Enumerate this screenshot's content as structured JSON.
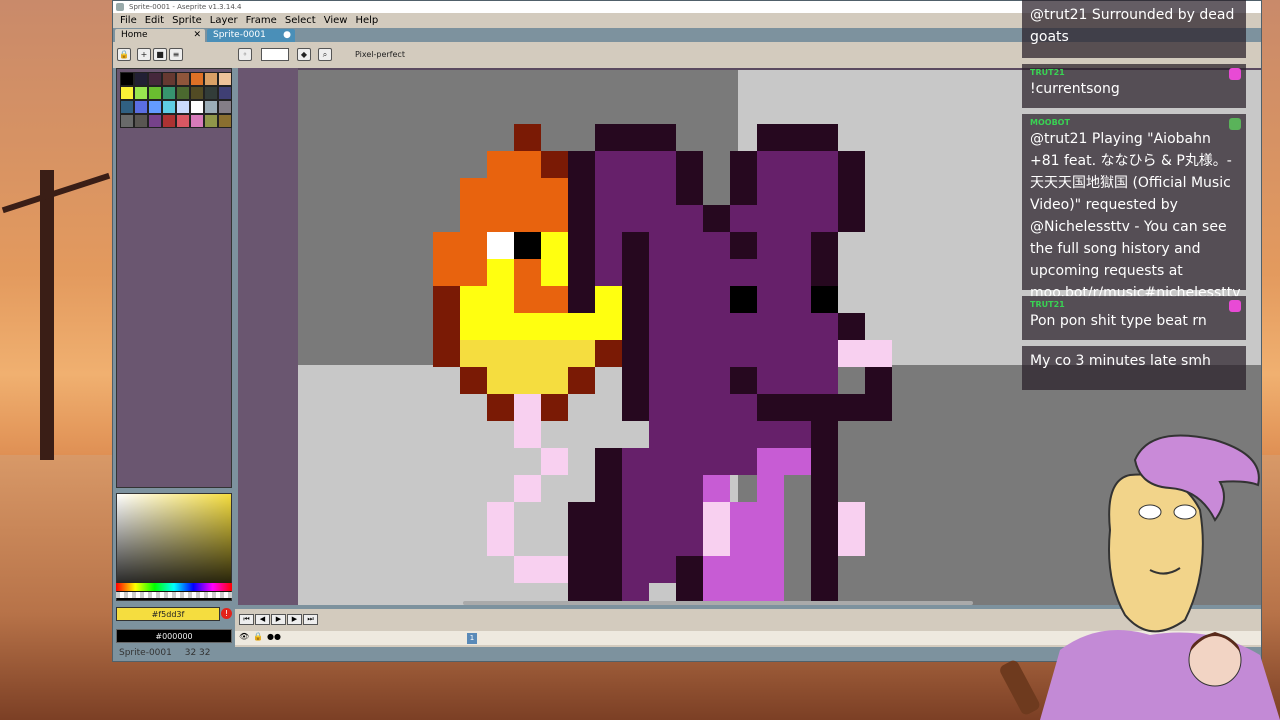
{
  "window": {
    "title": "Sprite-0001 - Aseprite v1.3.14.4"
  },
  "menu": [
    "File",
    "Edit",
    "Sprite",
    "Layer",
    "Frame",
    "Select",
    "View",
    "Help"
  ],
  "tabs": {
    "home": "Home",
    "sprite": "Sprite-0001"
  },
  "toolbar": {
    "pixel_perfect": "Pixel-perfect"
  },
  "colors": {
    "foreground_label": "#f5dd3f",
    "background_label": "#000000"
  },
  "status": {
    "sprite": "Sprite-0001",
    "dimensions": "32 32"
  },
  "timeline": {
    "frame": "1"
  },
  "chat": [
    {
      "user": "",
      "text": "@trut21 Surrounded by dead goats"
    },
    {
      "user": "TRUT21",
      "text": "!currentsong"
    },
    {
      "user": "MOOBOT",
      "text": "@trut21 Playing \"Aiobahn +81 feat. ななひら & P丸様。- 天天天国地獄国 (Official Music Video)\" requested by @Nichelessttv - You can see the full song history and upcoming requests at moo.bot/r/music#nichelessttv"
    },
    {
      "user": "TRUT21",
      "text": "Pon pon shit type beat rn"
    },
    {
      "user": "",
      "text": "My co 3 minutes late smh"
    }
  ]
}
